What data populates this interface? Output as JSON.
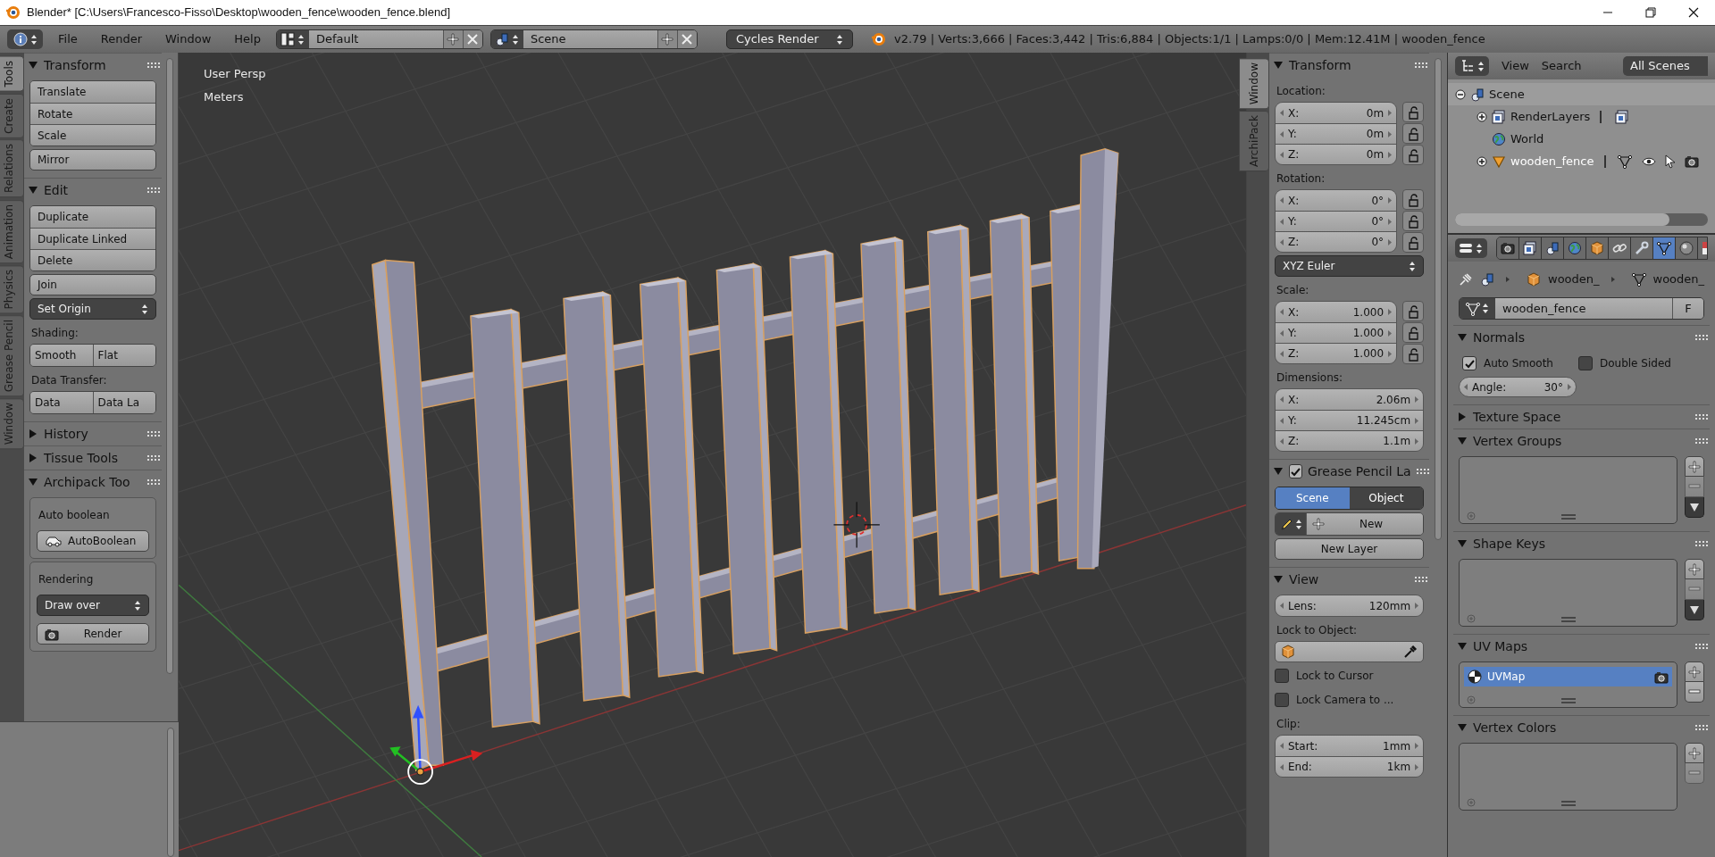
{
  "window": {
    "title": "Blender* [C:\\Users\\Francesco-Fisso\\Desktop\\wooden_fence\\wooden_fence.blend]"
  },
  "header": {
    "menus": [
      "File",
      "Render",
      "Window",
      "Help"
    ],
    "screen_layout": "Default",
    "scene": "Scene",
    "render_engine": "Cycles Render",
    "stats": "v2.79 | Verts:3,666 | Faces:3,442 | Tris:6,884 | Objects:1/1 | Lamps:0/0 | Mem:12.41M | wooden_fence"
  },
  "tool_shelf": {
    "tabs": [
      {
        "label": "Tools",
        "selected": true
      },
      {
        "label": "Create",
        "selected": false
      },
      {
        "label": "Relations",
        "selected": false
      },
      {
        "label": "Animation",
        "selected": false
      },
      {
        "label": "Physics",
        "selected": false
      },
      {
        "label": "Grease Pencil",
        "selected": false
      },
      {
        "label": "Window",
        "selected": false
      }
    ],
    "panels": [
      {
        "title": "Transform",
        "expanded": true,
        "items": [
          {
            "kind": "buttons",
            "labels": [
              "Translate",
              "Rotate",
              "Scale"
            ]
          },
          {
            "kind": "button",
            "label": "Mirror"
          }
        ]
      },
      {
        "title": "Edit",
        "expanded": true,
        "items": [
          {
            "kind": "buttons",
            "labels": [
              "Duplicate",
              "Duplicate Linked",
              "Delete"
            ]
          },
          {
            "kind": "button",
            "label": "Join"
          },
          {
            "kind": "dropdown",
            "value": "Set Origin"
          },
          {
            "kind": "label",
            "text": "Shading:"
          },
          {
            "kind": "row",
            "labels": [
              "Smooth",
              "Flat"
            ]
          },
          {
            "kind": "label",
            "text": "Data Transfer:"
          },
          {
            "kind": "row",
            "labels": [
              "Data",
              "Data La"
            ]
          }
        ]
      },
      {
        "title": "History",
        "expanded": false
      },
      {
        "title": "Tissue Tools",
        "expanded": false
      },
      {
        "title": "Archipack Too",
        "expanded": true,
        "items": [
          {
            "kind": "box",
            "items": [
              {
                "kind": "label",
                "text": "Auto boolean"
              },
              {
                "kind": "car_button",
                "label": "AutoBoolean"
              }
            ]
          },
          {
            "kind": "box",
            "items": [
              {
                "kind": "label",
                "text": "Rendering"
              },
              {
                "kind": "dropdown",
                "value": "Draw over"
              },
              {
                "kind": "camera_button",
                "label": "Render"
              }
            ]
          }
        ]
      }
    ]
  },
  "viewport": {
    "view_name": "User Persp",
    "units": "Meters"
  },
  "n_panel": {
    "tabs": [
      {
        "label": "Window",
        "selected": true
      },
      {
        "label": "ArchiPack",
        "selected": false
      }
    ],
    "panels": [
      {
        "title": "Transform",
        "expanded": true,
        "items": [
          {
            "kind": "label",
            "text": "Location:"
          },
          {
            "kind": "fields",
            "lockable": true,
            "rows": [
              {
                "label": "X:",
                "value": "0m"
              },
              {
                "label": "Y:",
                "value": "0m"
              },
              {
                "label": "Z:",
                "value": "0m"
              }
            ]
          },
          {
            "kind": "label",
            "text": "Rotation:"
          },
          {
            "kind": "fields",
            "lockable": true,
            "rows": [
              {
                "label": "X:",
                "value": "0°"
              },
              {
                "label": "Y:",
                "value": "0°"
              },
              {
                "label": "Z:",
                "value": "0°"
              }
            ]
          },
          {
            "kind": "dropdown",
            "value": "XYZ Euler"
          },
          {
            "kind": "label",
            "text": "Scale:"
          },
          {
            "kind": "fields",
            "lockable": true,
            "rows": [
              {
                "label": "X:",
                "value": "1.000"
              },
              {
                "label": "Y:",
                "value": "1.000"
              },
              {
                "label": "Z:",
                "value": "1.000"
              }
            ]
          },
          {
            "kind": "label",
            "text": "Dimensions:"
          },
          {
            "kind": "fields",
            "lockable": false,
            "rows": [
              {
                "label": "X:",
                "value": "2.06m"
              },
              {
                "label": "Y:",
                "value": "11.245cm"
              },
              {
                "label": "Z:",
                "value": "1.1m"
              }
            ]
          }
        ]
      },
      {
        "title": "Grease Pencil La",
        "checked": true,
        "expanded": true,
        "items": [
          {
            "kind": "toggle",
            "options": [
              {
                "label": "Scene",
                "selected": true
              },
              {
                "label": "Object",
                "selected": false
              }
            ]
          },
          {
            "kind": "new",
            "label": "New"
          },
          {
            "kind": "button",
            "label": "New Layer",
            "centered": true
          }
        ]
      },
      {
        "title": "View",
        "expanded": true,
        "items": [
          {
            "kind": "fields",
            "lockable": false,
            "rows": [
              {
                "label": "Lens:",
                "value": "120mm"
              }
            ]
          },
          {
            "kind": "label",
            "text": "Lock to Object:"
          },
          {
            "kind": "object_field"
          },
          {
            "kind": "checkbox",
            "label": "Lock to Cursor",
            "checked": false
          },
          {
            "kind": "checkbox",
            "label": "Lock Camera to ...",
            "checked": false
          },
          {
            "kind": "label",
            "text": "Clip:"
          },
          {
            "kind": "fields",
            "lockable": false,
            "rows": [
              {
                "label": "Start:",
                "value": "1mm"
              },
              {
                "label": "End:",
                "value": "1km"
              }
            ]
          }
        ]
      }
    ]
  },
  "outliner": {
    "menus": [
      "View",
      "Search"
    ],
    "display_mode": "All Scenes",
    "tree": [
      {
        "label": "Scene",
        "kind": "scene",
        "expanded": true,
        "children": [
          {
            "label": "RenderLayers",
            "kind": "render_layers",
            "expanded": false
          },
          {
            "label": "World",
            "kind": "world"
          },
          {
            "label": "wooden_fence",
            "kind": "mesh_object",
            "expanded": false
          }
        ]
      }
    ]
  },
  "properties": {
    "tabs": [
      {
        "kind": "render",
        "selected": false
      },
      {
        "kind": "render_layers",
        "selected": false
      },
      {
        "kind": "scene",
        "selected": false
      },
      {
        "kind": "world",
        "selected": false
      },
      {
        "kind": "object",
        "selected": false
      },
      {
        "kind": "constraints",
        "selected": false
      },
      {
        "kind": "modifiers",
        "selected": false
      },
      {
        "kind": "data",
        "selected": true
      },
      {
        "kind": "material",
        "selected": false
      },
      {
        "kind": "texture",
        "selected": false
      }
    ],
    "breadcrumbs": [
      "wooden_",
      "wooden_"
    ],
    "datablock": {
      "name": "wooden_fence",
      "fake_user": "F"
    },
    "panels": [
      {
        "title": "Normals",
        "expanded": true,
        "items": [
          {
            "kind": "checkbox_pair",
            "checks": [
              {
                "label": "Auto Smooth",
                "checked": true
              },
              {
                "label": "Double Sided",
                "checked": false
              }
            ]
          },
          {
            "kind": "slider",
            "label": "Angle:",
            "value": "30°"
          }
        ]
      },
      {
        "title": "Texture Space",
        "expanded": false
      },
      {
        "title": "Vertex Groups",
        "expanded": true,
        "items": [
          {
            "kind": "list",
            "specials": true
          }
        ]
      },
      {
        "title": "Shape Keys",
        "expanded": true,
        "items": [
          {
            "kind": "list",
            "specials": true
          }
        ]
      },
      {
        "title": "UV Maps",
        "expanded": true,
        "items": [
          {
            "kind": "list",
            "rows": [
              {
                "label": "UVMap",
                "selected": true
              }
            ],
            "specials": false
          }
        ]
      },
      {
        "title": "Vertex Colors",
        "expanded": true,
        "items": [
          {
            "kind": "list",
            "specials": false
          }
        ]
      }
    ]
  }
}
